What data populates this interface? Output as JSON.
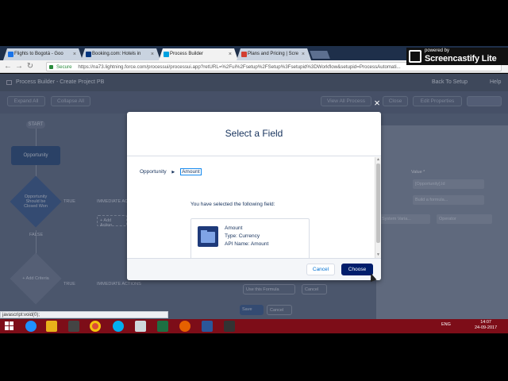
{
  "browser": {
    "tabs": [
      {
        "label": "Flights to Bogotá - Goo",
        "icon": "google-flights-icon",
        "color": "#1a73e8"
      },
      {
        "label": "Booking.com: Hotels in",
        "icon": "booking-icon",
        "color": "#003580"
      },
      {
        "label": "Process Builder",
        "icon": "salesforce-icon",
        "color": "#00a1e0"
      },
      {
        "label": "Plans and Pricing | Scre",
        "icon": "screencastify-icon",
        "color": "#d23f31"
      }
    ],
    "secure_label": "Secure",
    "url": "https://na73.lightning.force.com/processui/processui.app?retURL=%2Fui%2Fsetup%2FSetup%3Fsetupid%3DWorkflow&setupid=ProcessAutomati..."
  },
  "screencastify": {
    "powered_by": "powered by",
    "name": "Screencastify Lite"
  },
  "app": {
    "header_title": "Process Builder - Create Project PB",
    "back_to_setup": "Back To Setup",
    "help": "Help",
    "toolbar": {
      "expand_all": "Expand All",
      "collapse_all": "Collapse All",
      "view_all": "View All Process",
      "close": "Close",
      "edit_properties": "Edit Properties"
    },
    "canvas": {
      "start": "START",
      "object_node": "Opportunity",
      "criteria_node": "Opportunity Should be Closed Won",
      "true_label": "TRUE",
      "false_label": "FALSE",
      "immediate_actions": "IMMEDIATE ACTIONS",
      "add_action": "+ Add Action",
      "add_criteria": "+ Add Criteria"
    },
    "right_panel": {
      "value_label": "Value *",
      "field_value": "[Opportunity].Id",
      "build_formula": "Build a formula...",
      "system_variable": "System Varia...",
      "operator": "Operator",
      "use_formula": "Use this Formula",
      "cancel": "Cancel",
      "save": "Save",
      "cancel2": "Cancel"
    }
  },
  "modal": {
    "title": "Select a Field",
    "breadcrumb_object": "Opportunity",
    "breadcrumb_field": "Amount",
    "info_text": "You have selected the following field:",
    "field_name": "Amount",
    "field_type": "Type: Currency",
    "api_name": "API Name: Amount",
    "cancel_label": "Cancel",
    "choose_label": "Choose"
  },
  "status_url": "javascript:void(0);",
  "taskbar": {
    "lang": "ENG",
    "time": "14:07",
    "date": "24-09-2017"
  }
}
